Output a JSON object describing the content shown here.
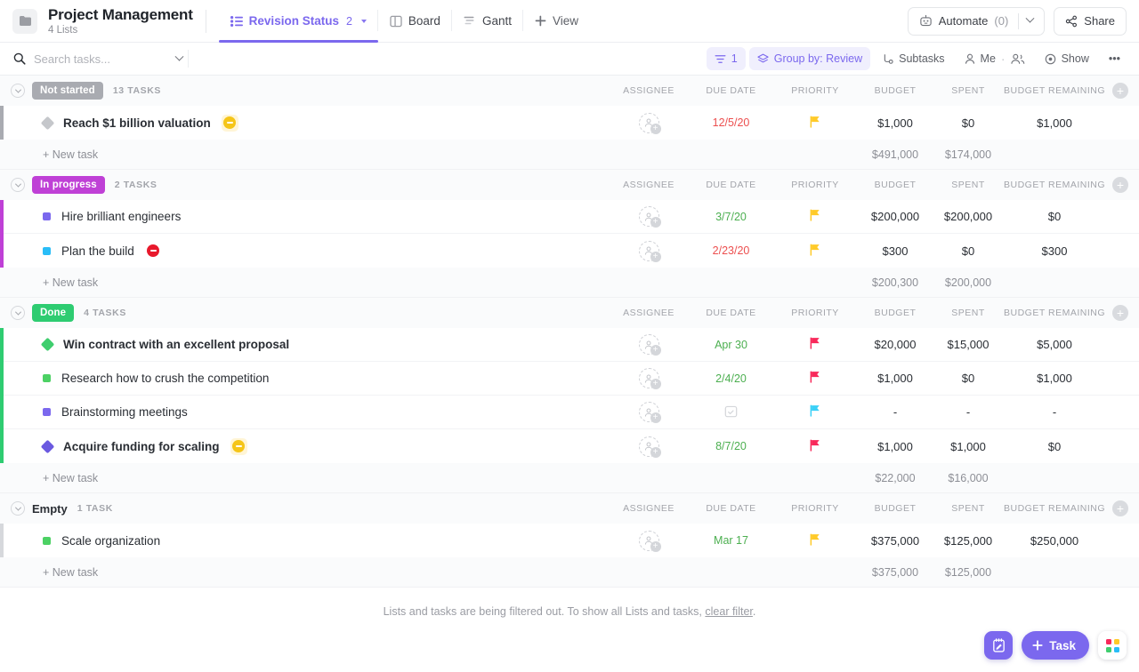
{
  "header": {
    "folder_icon": "folder-icon",
    "title": "Project Management",
    "subtitle": "4 Lists",
    "tabs": [
      {
        "label": "Revision Status",
        "icon": "list-view-icon",
        "count": "2",
        "active": true,
        "has_caret": true
      },
      {
        "label": "Board",
        "icon": "board-view-icon",
        "count": "",
        "active": false,
        "has_caret": false
      },
      {
        "label": "Gantt",
        "icon": "gantt-view-icon",
        "count": "",
        "active": false,
        "has_caret": false
      },
      {
        "label": "View",
        "icon": "plus-icon",
        "count": "",
        "active": false,
        "has_caret": false
      }
    ],
    "automate_label": "Automate",
    "automate_count": "(0)",
    "share_label": "Share"
  },
  "toolbar": {
    "search_placeholder": "Search tasks...",
    "search_value": "",
    "filter_count": "1",
    "group_by_label": "Group by: Review",
    "subtasks_label": "Subtasks",
    "me_label": "Me",
    "show_label": "Show",
    "more_label": "•••"
  },
  "columns": [
    "ASSIGNEE",
    "DUE DATE",
    "PRIORITY",
    "BUDGET",
    "SPENT",
    "BUDGET REMAINING"
  ],
  "new_task_label": "+ New task",
  "groups": [
    {
      "name": "Not started",
      "badge_color": "#a9abb1",
      "badge_style": "pill",
      "accent": "#a9abb1",
      "count_label": "13 TASKS",
      "tasks": [
        {
          "name": "Reach $1 billion valuation",
          "bold": true,
          "marker": "diamond",
          "marker_color": "#c5c7cb",
          "tag": "blocked-yellow",
          "assignee": "",
          "due": "12/5/20",
          "due_state": "overdue",
          "priority": "normal",
          "priority_color": "#ffca28",
          "budget": "$1,000",
          "spent": "$0",
          "remaining": "$1,000"
        }
      ],
      "totals": {
        "budget": "$491,000",
        "spent": "$174,000",
        "remaining": ""
      }
    },
    {
      "name": "In progress",
      "badge_color": "#bf40d6",
      "badge_style": "pill",
      "accent": "#bf40d6",
      "count_label": "2 TASKS",
      "tasks": [
        {
          "name": "Hire brilliant engineers",
          "bold": false,
          "marker": "square",
          "marker_color": "#7b68ee",
          "tag": "",
          "assignee": "",
          "due": "3/7/20",
          "due_state": "normal",
          "priority": "normal",
          "priority_color": "#ffca28",
          "budget": "$200,000",
          "spent": "$200,000",
          "remaining": "$0"
        },
        {
          "name": "Plan the build",
          "bold": false,
          "marker": "square",
          "marker_color": "#29bdf7",
          "tag": "blocked-red",
          "assignee": "",
          "due": "2/23/20",
          "due_state": "overdue",
          "priority": "normal",
          "priority_color": "#ffca28",
          "budget": "$300",
          "spent": "$0",
          "remaining": "$300"
        }
      ],
      "totals": {
        "budget": "$200,300",
        "spent": "$200,000",
        "remaining": ""
      }
    },
    {
      "name": "Done",
      "badge_color": "#2ecc71",
      "badge_style": "pill",
      "accent": "#2ecc71",
      "count_label": "4 TASKS",
      "tasks": [
        {
          "name": "Win contract with an excellent proposal",
          "bold": true,
          "marker": "diamond",
          "marker_color": "#3fce6e",
          "tag": "",
          "assignee": "",
          "due": "Apr 30",
          "due_state": "normal",
          "priority": "urgent",
          "priority_color": "#f8285a",
          "budget": "$20,000",
          "spent": "$15,000",
          "remaining": "$5,000"
        },
        {
          "name": "Research how to crush the competition",
          "bold": false,
          "marker": "square",
          "marker_color": "#4cd164",
          "tag": "",
          "assignee": "",
          "due": "2/4/20",
          "due_state": "normal",
          "priority": "urgent",
          "priority_color": "#f8285a",
          "budget": "$1,000",
          "spent": "$0",
          "remaining": "$1,000"
        },
        {
          "name": "Brainstorming meetings",
          "bold": false,
          "marker": "square",
          "marker_color": "#7b68ee",
          "tag": "",
          "assignee": "",
          "due": "",
          "due_state": "empty",
          "priority": "low",
          "priority_color": "#3ad0f7",
          "budget": "-",
          "spent": "-",
          "remaining": "-"
        },
        {
          "name": "Acquire funding for scaling",
          "bold": true,
          "marker": "diamond",
          "marker_color": "#6b5ae0",
          "tag": "blocked-yellow",
          "assignee": "",
          "due": "8/7/20",
          "due_state": "normal",
          "priority": "urgent",
          "priority_color": "#f8285a",
          "budget": "$1,000",
          "spent": "$1,000",
          "remaining": "$0"
        }
      ],
      "totals": {
        "budget": "$22,000",
        "spent": "$16,000",
        "remaining": ""
      }
    },
    {
      "name": "Empty",
      "badge_color": "",
      "badge_style": "plain",
      "accent": "#d6d8dc",
      "count_label": "1 TASK",
      "tasks": [
        {
          "name": "Scale organization",
          "bold": false,
          "marker": "square",
          "marker_color": "#4cd164",
          "tag": "",
          "assignee": "",
          "due": "Mar 17",
          "due_state": "normal",
          "priority": "normal",
          "priority_color": "#ffca28",
          "budget": "$375,000",
          "spent": "$125,000",
          "remaining": "$250,000"
        }
      ],
      "totals": {
        "budget": "$375,000",
        "spent": "$125,000",
        "remaining": ""
      }
    }
  ],
  "footer": {
    "text_before": "Lists and tasks are being filtered out. To show all Lists and tasks, ",
    "link": "clear filter",
    "text_after": "."
  },
  "fabs": {
    "note_label": "note-icon",
    "task_label": "Task",
    "apps_label": "apps-icon"
  },
  "colors": {
    "accent": "#7b68ee",
    "accent_soft": "#f0effd",
    "overdue": "#ec4f4f",
    "ok": "#4caf50"
  }
}
